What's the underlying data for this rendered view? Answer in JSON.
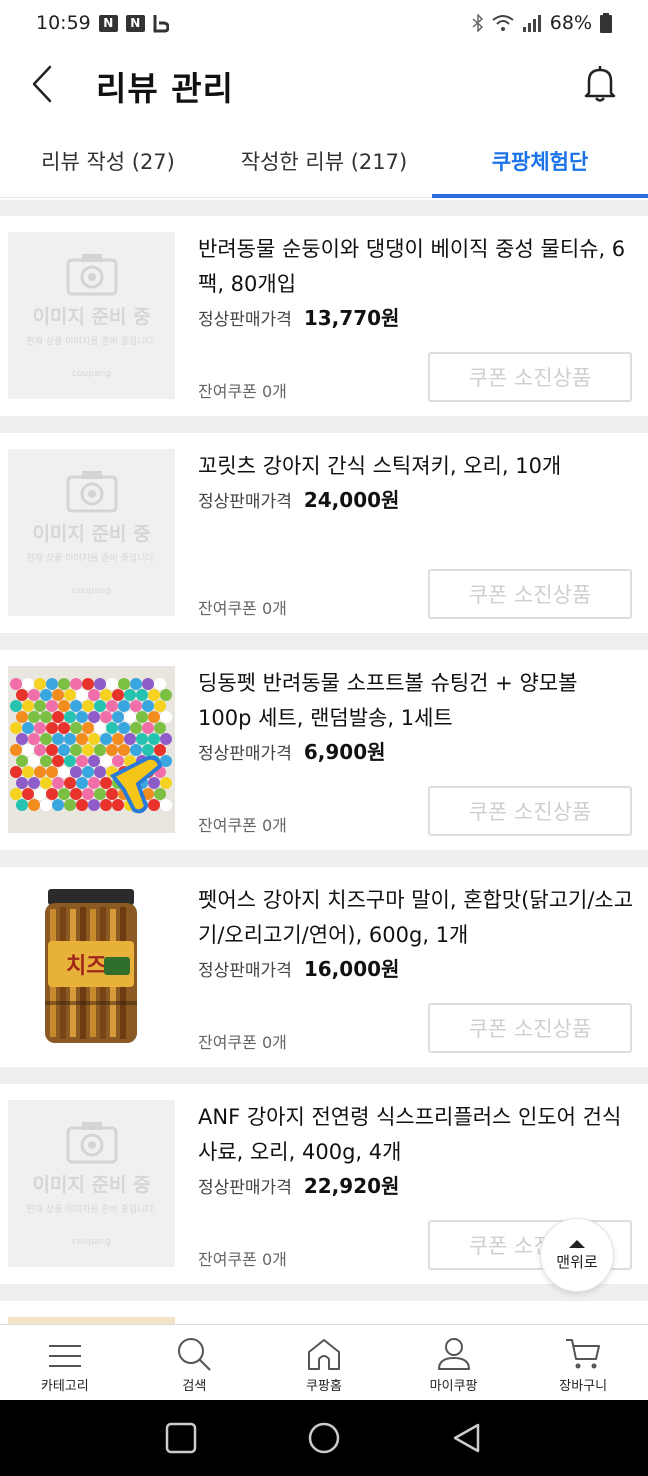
{
  "status_bar": {
    "time": "10:59",
    "badges": [
      "N",
      "N"
    ],
    "battery": "68%"
  },
  "header": {
    "title": "리뷰 관리",
    "icons": [
      "back-arrow-icon",
      "bell-icon"
    ]
  },
  "tabs": [
    {
      "label": "리뷰 작성 (27)",
      "active": false
    },
    {
      "label": "작성한 리뷰 (217)",
      "active": false
    },
    {
      "label": "쿠팡체험단",
      "active": true
    }
  ],
  "placeholder": {
    "text": "이미지 준비 중",
    "subtext": "현재 상품 이미지를 준비 중입니다.",
    "brand": "coupang"
  },
  "price_label": "정상판매가격",
  "items": [
    {
      "name": "반려동물 순둥이와 댕댕이 베이직 중성 물티슈, 6팩, 80개입",
      "price": "13,770원",
      "coupon_left": "잔여쿠폰 0개",
      "button": "쿠폰 소진상품",
      "image": "placeholder"
    },
    {
      "name": "꼬릿츠 강아지 간식 스틱져키, 오리, 10개",
      "price": "24,000원",
      "coupon_left": "잔여쿠폰 0개",
      "button": "쿠폰 소진상품",
      "image": "placeholder"
    },
    {
      "name": "딩동펫 반려동물 소프트볼 슈팅건 + 양모볼 100p 세트, 랜덤발송, 1세트",
      "price": "6,900원",
      "coupon_left": "잔여쿠폰 0개",
      "button": "쿠폰 소진상품",
      "image": "pompom-balls-photo"
    },
    {
      "name": "펫어스 강아지 치즈구마 말이, 혼합맛(닭고기/소고기/오리고기/연어), 600g, 1개",
      "price": "16,000원",
      "coupon_left": "잔여쿠폰 0개",
      "button": "쿠폰 소진상품",
      "image": "treat-jar-photo"
    },
    {
      "name": "ANF 강아지 전연령 식스프리플러스 인도어 건식사료, 오리, 400g, 4개",
      "price": "22,920원",
      "coupon_left": "잔여쿠폰 0개",
      "button": "쿠폰 소진상품",
      "image": "placeholder"
    }
  ],
  "scroll_top_label": "맨위로",
  "bottom_nav": [
    {
      "label": "카테고리",
      "icon": "menu-icon"
    },
    {
      "label": "검색",
      "icon": "search-icon"
    },
    {
      "label": "쿠팡홈",
      "icon": "home-icon"
    },
    {
      "label": "마이쿠팡",
      "icon": "user-icon"
    },
    {
      "label": "장바구니",
      "icon": "cart-icon"
    }
  ],
  "colors": {
    "accent": "#2f6bdc",
    "divider": "#eeeeee",
    "disabled": "#cfcfcf"
  }
}
